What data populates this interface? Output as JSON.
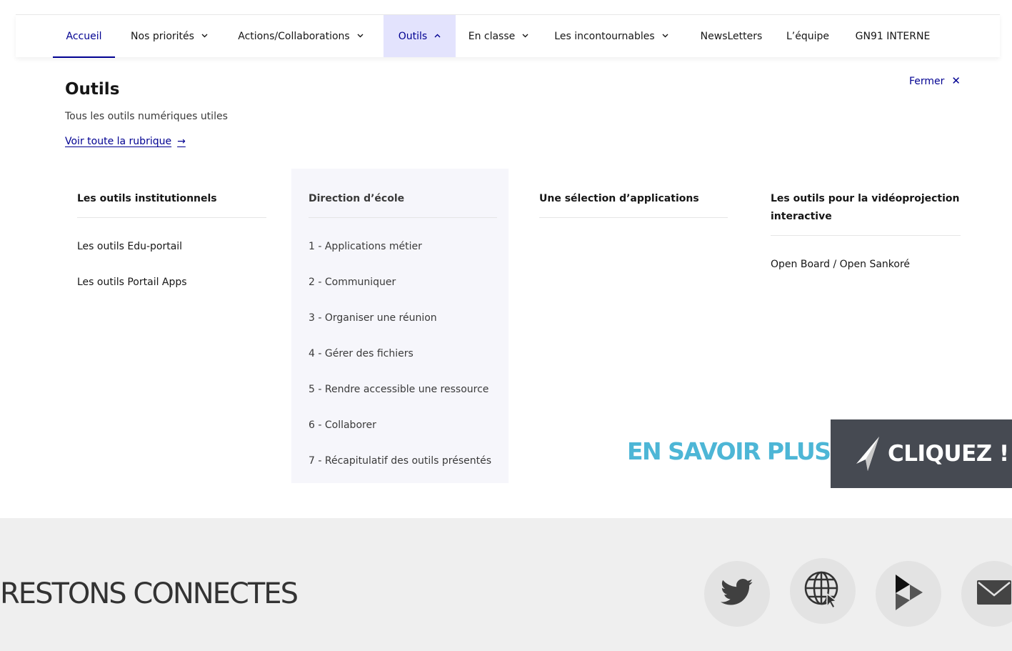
{
  "nav": {
    "items": [
      {
        "label": "Accueil",
        "chevron": ""
      },
      {
        "label": "Nos priorités",
        "chevron": "⌄"
      },
      {
        "label": "Actions/Collaborations",
        "chevron": "⌄"
      },
      {
        "label": "Outils",
        "chevron": "⌃"
      },
      {
        "label": "En classe",
        "chevron": "⌄"
      },
      {
        "label": "Les incontournables",
        "chevron": "⌄"
      },
      {
        "label": "NewsLetters",
        "chevron": ""
      },
      {
        "label": "L’équipe",
        "chevron": ""
      },
      {
        "label": "GN91 INTERNE",
        "chevron": ""
      }
    ],
    "current": "Accueil",
    "expanded": "Outils"
  },
  "megamenu": {
    "title": "Outils",
    "description": "Tous les outils numériques utiles",
    "link_label": "Voir toute la rubrique",
    "link_arrow": "→",
    "close_label": "Fermer",
    "close_icon": "✕",
    "columns": [
      {
        "heading": "Les outils institutionnels",
        "items": [
          "Les outils Edu-portail",
          "Les outils Portail Apps"
        ]
      },
      {
        "heading": "Direction d’école",
        "items": [
          "1 - Applications métier",
          "2 - Communiquer",
          "3 - Organiser une réunion",
          "4 - Gérer des fichiers",
          "5 - Rendre accessible une ressource",
          "6 - Collaborer",
          "7 - Récapitulatif des outils présentés"
        ]
      },
      {
        "heading": "Une sélection d’applications",
        "items": []
      },
      {
        "heading": "Les outils pour la vidéoprojection interactive",
        "items": [
          "Open Board / Open Sankoré"
        ]
      }
    ]
  },
  "banner": {
    "savoir_label": "EN SAVOIR PLUS",
    "cliquez_label": "CLIQUEZ !",
    "icon": "cursor-arrow-icon"
  },
  "footer": {
    "title": "RESTONS CONNECTES",
    "social": [
      "twitter-icon",
      "globe-icon",
      "media-player-icon",
      "mail-icon"
    ]
  },
  "colors": {
    "primary": "#000091",
    "active_bg": "#e3e3fd",
    "shaded_col": "#f6f6fb",
    "savoir": "#4db6d6",
    "cliquez_bg": "#464a52",
    "footer_bg": "#efefef"
  }
}
